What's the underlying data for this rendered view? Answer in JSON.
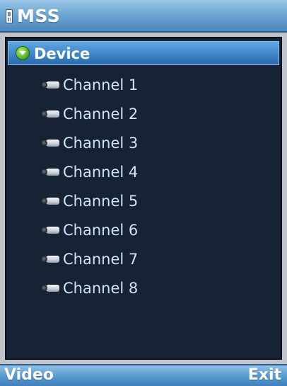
{
  "header": {
    "title": "MSS",
    "icon": "phone-icon"
  },
  "tree": {
    "device": {
      "label": "Device",
      "icon": "expand-icon",
      "selected": true
    },
    "channels": [
      {
        "label": "Channel 1",
        "icon": "camera-icon"
      },
      {
        "label": "Channel 2",
        "icon": "camera-icon"
      },
      {
        "label": "Channel 3",
        "icon": "camera-icon"
      },
      {
        "label": "Channel 4",
        "icon": "camera-icon"
      },
      {
        "label": "Channel 5",
        "icon": "camera-icon"
      },
      {
        "label": "Channel 6",
        "icon": "camera-icon"
      },
      {
        "label": "Channel 7",
        "icon": "camera-icon"
      },
      {
        "label": "Channel 8",
        "icon": "camera-icon"
      }
    ]
  },
  "softkeys": {
    "left": "Video",
    "right": "Exit"
  },
  "colors": {
    "selection": "#3e86c8",
    "list_background": "#172234",
    "channel_text": "#cfe3f7"
  }
}
